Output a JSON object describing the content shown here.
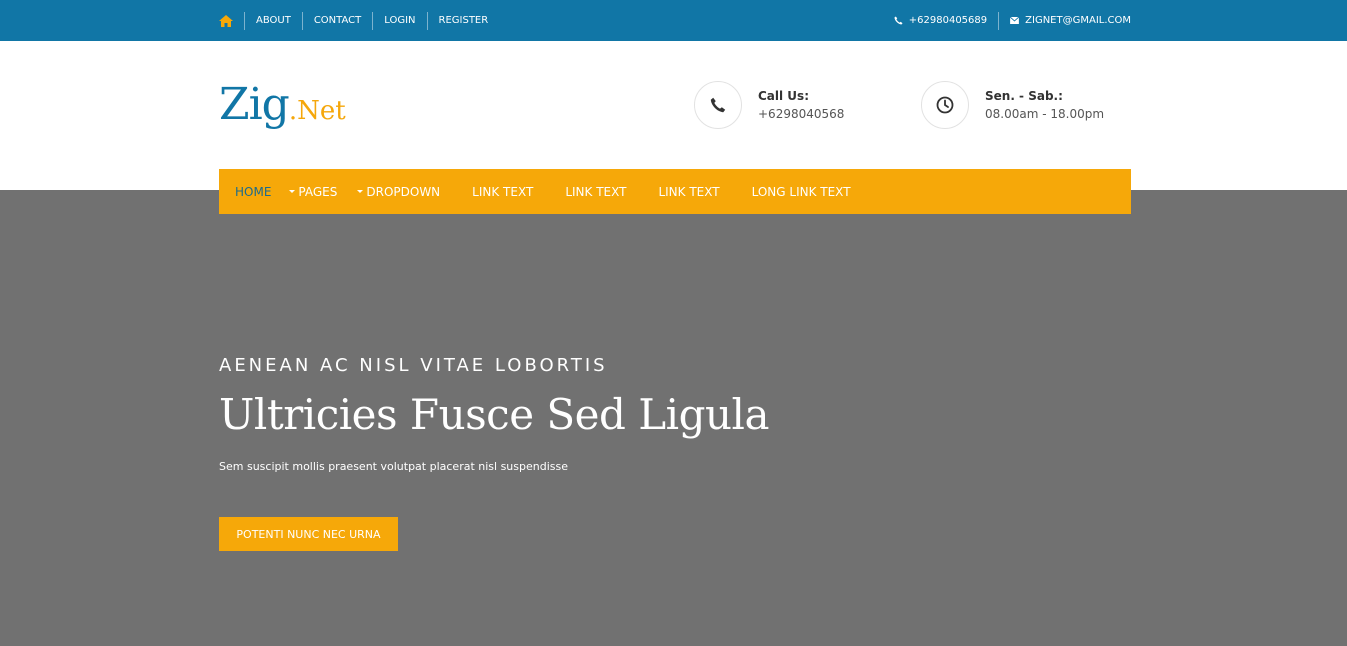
{
  "topbar": {
    "links": [
      "ABOUT",
      "CONTACT",
      "LOGIN",
      "REGISTER"
    ],
    "phone": "+62980405689",
    "email": "ZIGNET@GMAIL.COM"
  },
  "logo": {
    "main": "Zig",
    "dot": ".",
    "suffix": "Net"
  },
  "contact": {
    "call_label": "Call Us:",
    "call_value": "+6298040568",
    "hours_label": "Sen. - Sab.:",
    "hours_value": "08.00am - 18.00pm"
  },
  "nav": {
    "items": [
      "HOME",
      "PAGES",
      "DROPDOWN",
      "LINK TEXT",
      "LINK TEXT",
      "LINK TEXT",
      "LONG LINK TEXT"
    ]
  },
  "hero": {
    "kicker": "AENEAN AC NISL VITAE LOBORTIS",
    "title": "Ultricies Fusce Sed Ligula",
    "subtitle": "Sem suscipit mollis praesent volutpat placerat nisl suspendisse",
    "button": "POTENTI NUNC NEC URNA"
  },
  "colors": {
    "topbar": "#1176a6",
    "accent": "#f6a809",
    "hero_bg": "#717171",
    "nav_active": "#1c6b8c"
  }
}
